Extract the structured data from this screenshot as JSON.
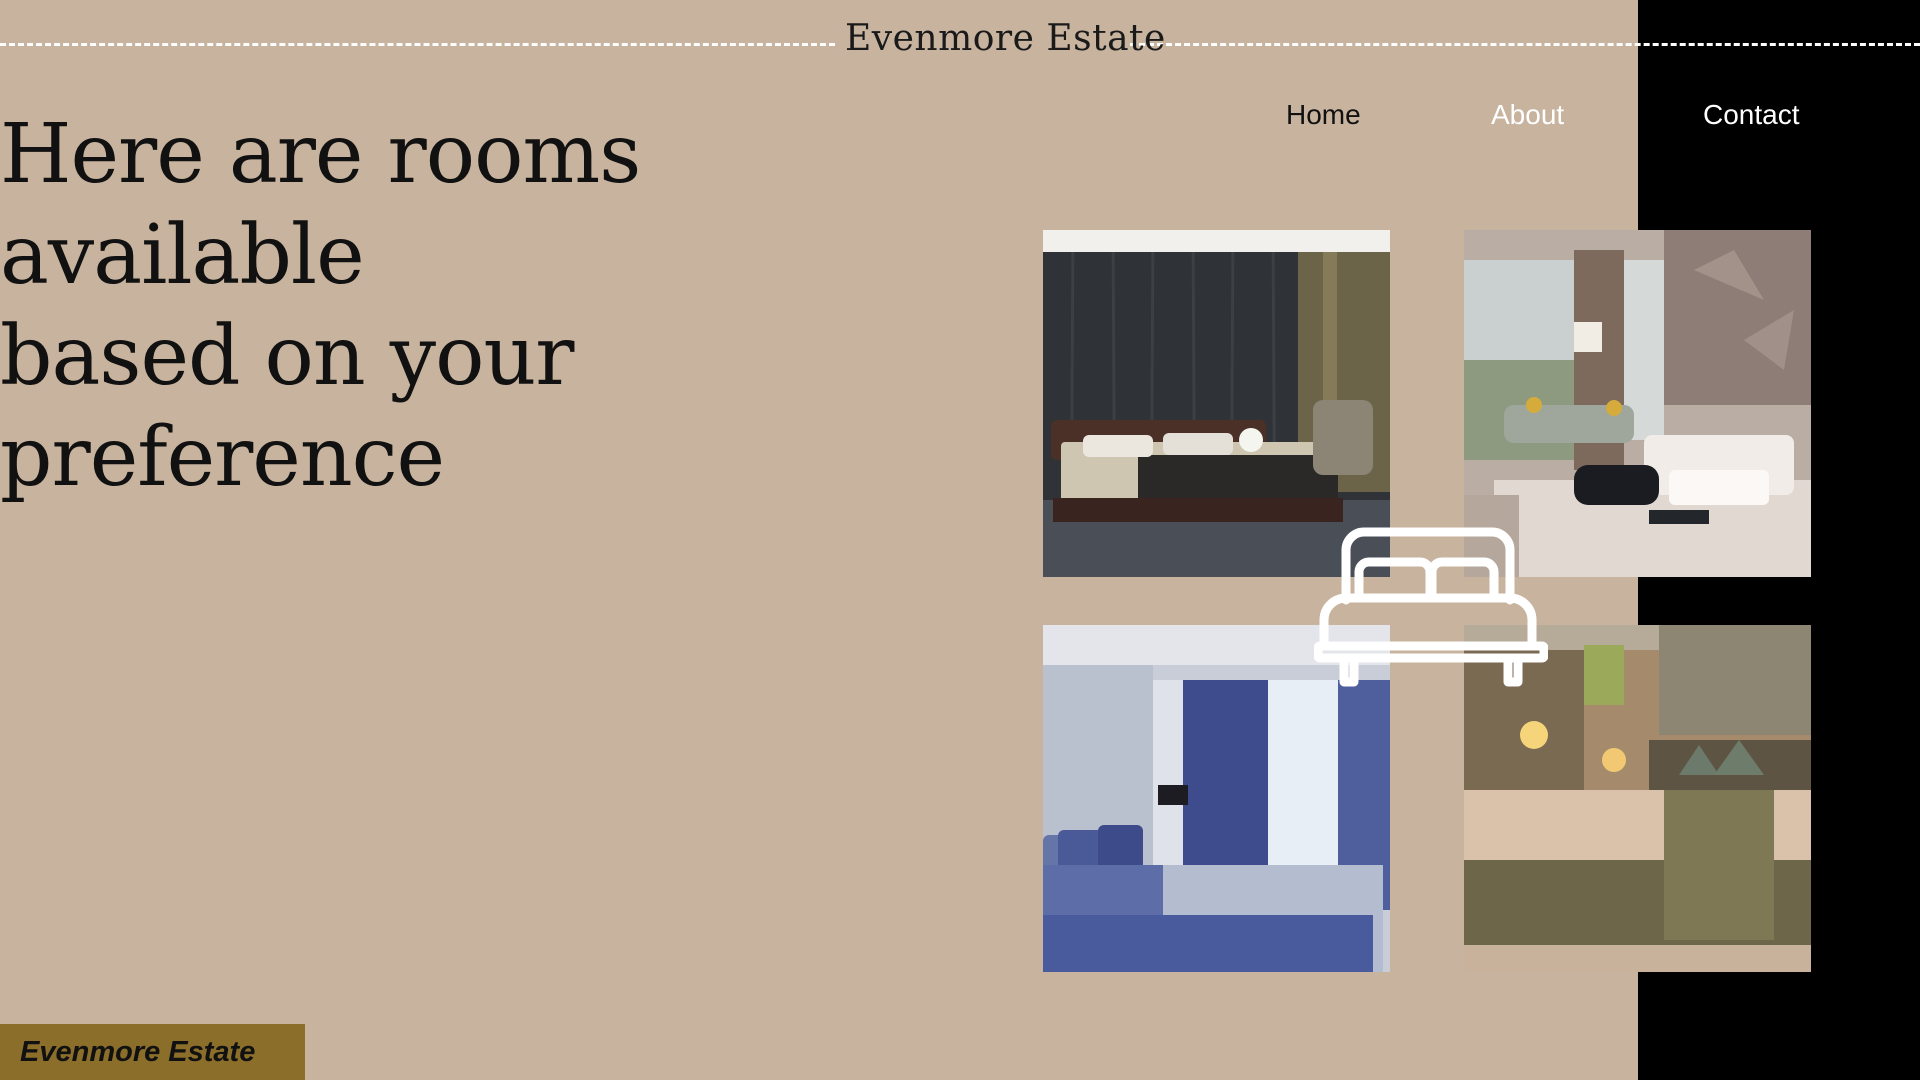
{
  "brand": {
    "name": "Evenmore Estate"
  },
  "nav": {
    "items": [
      {
        "label": "Home"
      },
      {
        "label": "About"
      },
      {
        "label": "Contact"
      }
    ]
  },
  "hero": {
    "headline_line1": "Here are rooms available",
    "headline_line2": "based on your preference"
  },
  "gallery": {
    "center_icon": "bed-icon",
    "photos": [
      {
        "subject": "dark wood-panelled bedroom"
      },
      {
        "subject": "bright hotel suite with sofa"
      },
      {
        "subject": "blue-curtained bedroom"
      },
      {
        "subject": "warm-lit hotel bedroom"
      }
    ]
  },
  "footer_badge": {
    "label": "Evenmore Estate"
  },
  "colors": {
    "background": "#C7B39E",
    "side_panel": "#000000",
    "badge": "#8A6E2A",
    "text_dark": "#111111",
    "text_light": "#FFFFFF"
  }
}
